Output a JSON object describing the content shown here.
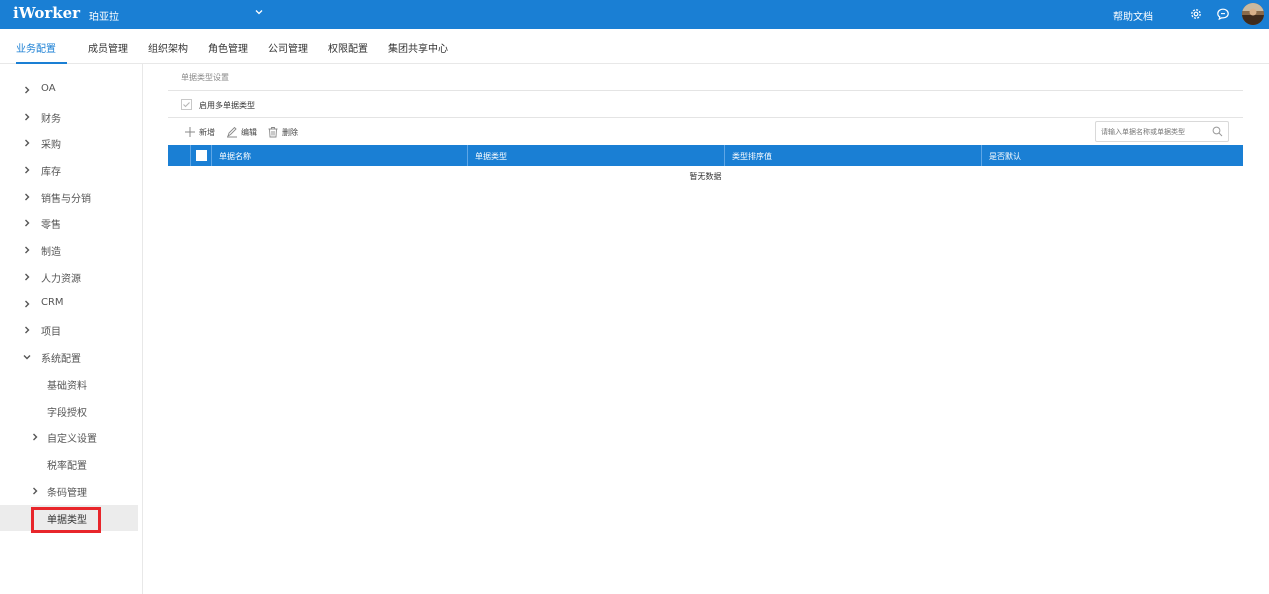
{
  "app": {
    "brand": "iWorker",
    "company": "珀亚拉",
    "help": "帮助文档"
  },
  "colors": {
    "primary": "#1a7fd4",
    "highlight": "#e8262b"
  },
  "icons": {
    "company_dropdown": "chevron-down-icon",
    "settings": "gear-icon",
    "chat": "chat-icon",
    "user": "avatar"
  },
  "nav": {
    "tabs": [
      {
        "label": "业务配置",
        "active": true
      },
      {
        "label": "成员管理"
      },
      {
        "label": "组织架构"
      },
      {
        "label": "角色管理"
      },
      {
        "label": "公司管理"
      },
      {
        "label": "权限配置"
      },
      {
        "label": "集团共享中心"
      }
    ]
  },
  "sidebar": {
    "items": [
      {
        "label": "OA",
        "state": "collapsed"
      },
      {
        "label": "财务",
        "state": "collapsed"
      },
      {
        "label": "采购",
        "state": "collapsed"
      },
      {
        "label": "库存",
        "state": "collapsed"
      },
      {
        "label": "销售与分销",
        "state": "collapsed"
      },
      {
        "label": "零售",
        "state": "collapsed"
      },
      {
        "label": "制造",
        "state": "collapsed"
      },
      {
        "label": "人力资源",
        "state": "collapsed"
      },
      {
        "label": "CRM",
        "state": "collapsed"
      },
      {
        "label": "项目",
        "state": "collapsed"
      },
      {
        "label": "系统配置",
        "state": "expanded"
      }
    ],
    "sub_items": [
      {
        "label": "基础资料"
      },
      {
        "label": "字段授权"
      },
      {
        "label": "自定义设置",
        "state": "collapsed"
      },
      {
        "label": "税率配置"
      },
      {
        "label": "条码管理",
        "state": "collapsed"
      },
      {
        "label": "单据类型",
        "selected": true
      }
    ]
  },
  "main": {
    "section_title": "单据类型设置",
    "checkbox_label": "启用多单据类型",
    "checkbox_checked": true,
    "toolbar": {
      "add": "新增",
      "edit": "编辑",
      "delete": "删除"
    },
    "search_placeholder": "请输入单据名称或单据类型",
    "table": {
      "columns": [
        "单据名称",
        "单据类型",
        "类型排序值",
        "是否默认"
      ],
      "empty_text": "暂无数据"
    }
  }
}
